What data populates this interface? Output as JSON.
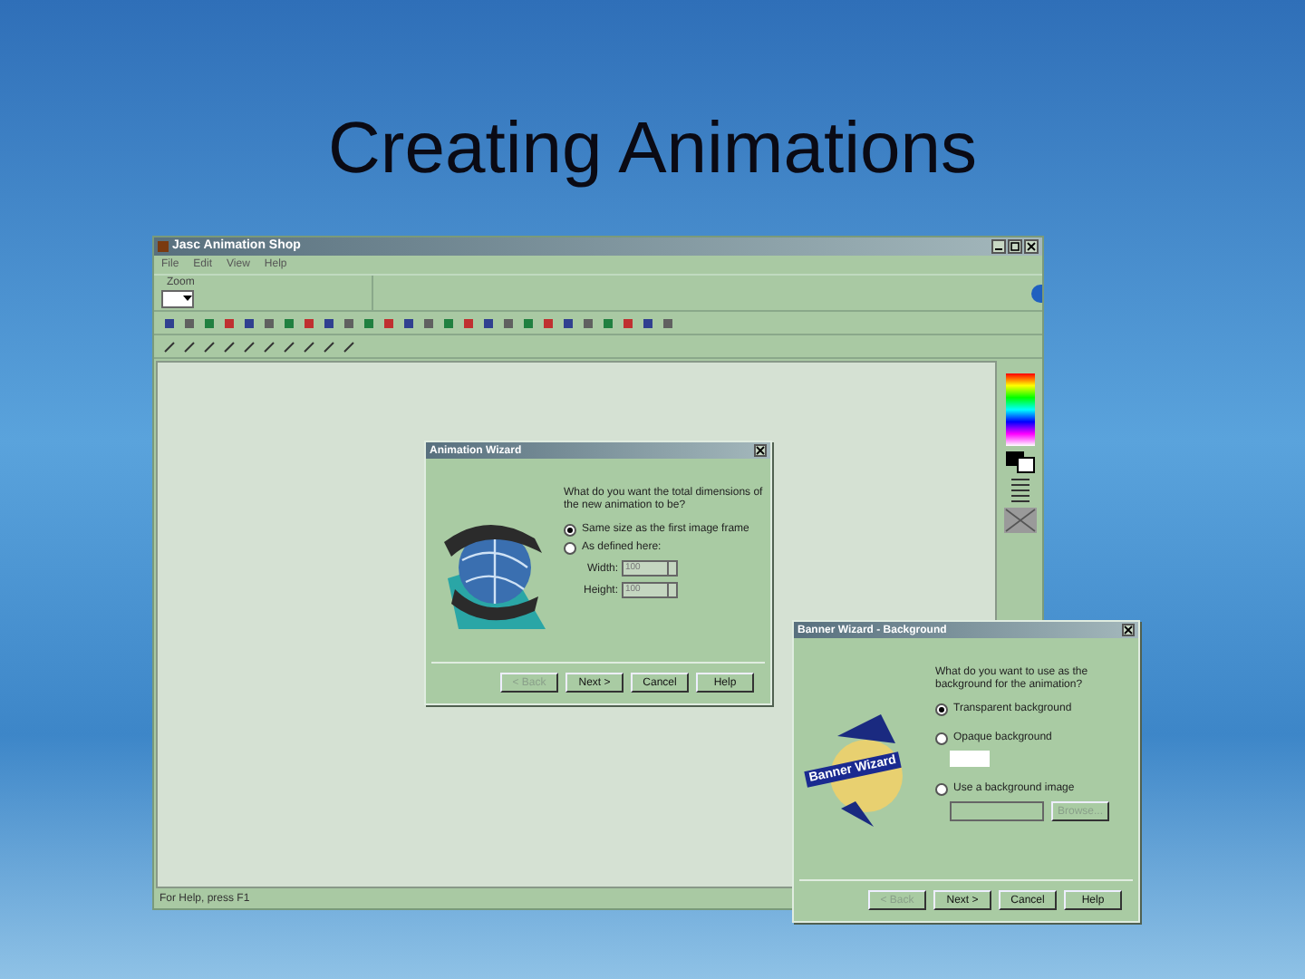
{
  "slide": {
    "title": "Creating Animations"
  },
  "app": {
    "title": "Jasc Animation Shop",
    "menu": [
      "File",
      "Edit",
      "View",
      "Help"
    ],
    "zoom_label": "Zoom",
    "status": "For Help, press F1"
  },
  "animation_wizard": {
    "title": "Animation Wizard",
    "question": "What do you want the total dimensions of the new animation to be?",
    "options": [
      {
        "label": "Same size as the first image frame",
        "selected": true
      },
      {
        "label": "As defined here:",
        "selected": false
      }
    ],
    "fields": [
      {
        "label": "Width:",
        "value": "100",
        "disabled": true
      },
      {
        "label": "Height:",
        "value": "100",
        "disabled": true
      }
    ],
    "buttons": [
      {
        "label": "< Back",
        "disabled": true
      },
      {
        "label": "Next >",
        "disabled": false
      },
      {
        "label": "Cancel",
        "disabled": false
      },
      {
        "label": "Help",
        "disabled": false
      }
    ]
  },
  "banner_wizard": {
    "title": "Banner Wizard - Background",
    "logo_text": "Banner Wizard",
    "question": "What do you want to use as the background for the animation?",
    "options": [
      {
        "label": "Transparent background",
        "selected": true,
        "kind": "plain"
      },
      {
        "label": "Opaque background",
        "selected": false,
        "kind": "color"
      },
      {
        "label": "Use a background image",
        "selected": false,
        "kind": "image"
      }
    ],
    "browse": "Browse...",
    "buttons": [
      {
        "label": "< Back",
        "disabled": true
      },
      {
        "label": "Next >",
        "disabled": false
      },
      {
        "label": "Cancel",
        "disabled": false
      },
      {
        "label": "Help",
        "disabled": false
      }
    ]
  }
}
